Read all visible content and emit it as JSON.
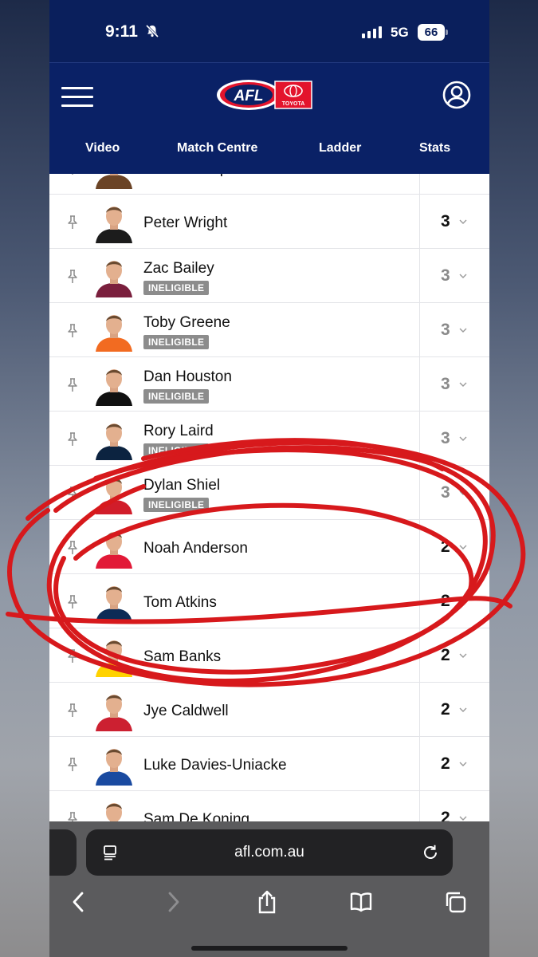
{
  "status_bar": {
    "time": "9:11",
    "network": "5G",
    "battery": "66"
  },
  "header": {
    "logo_text": "AFL",
    "sponsor_text": "TOYOTA",
    "nav": [
      "Video",
      "Match Centre",
      "Ladder",
      "Stats"
    ]
  },
  "players": [
    {
      "name": "James Worpel",
      "badge": "",
      "votes": "",
      "dim": false
    },
    {
      "name": "Peter Wright",
      "badge": "",
      "votes": "3",
      "dim": false
    },
    {
      "name": "Zac Bailey",
      "badge": "INELIGIBLE",
      "votes": "3",
      "dim": true
    },
    {
      "name": "Toby Greene",
      "badge": "INELIGIBLE",
      "votes": "3",
      "dim": true
    },
    {
      "name": "Dan Houston",
      "badge": "INELIGIBLE",
      "votes": "3",
      "dim": true
    },
    {
      "name": "Rory Laird",
      "badge": "INELIGIBLE",
      "votes": "3",
      "dim": true
    },
    {
      "name": "Dylan Shiel",
      "badge": "INELIGIBLE",
      "votes": "3",
      "dim": true
    },
    {
      "name": "Noah Anderson",
      "badge": "",
      "votes": "2",
      "dim": false
    },
    {
      "name": "Tom Atkins",
      "badge": "",
      "votes": "2",
      "dim": false
    },
    {
      "name": "Sam Banks",
      "badge": "",
      "votes": "2",
      "dim": false
    },
    {
      "name": "Jye Caldwell",
      "badge": "",
      "votes": "2",
      "dim": false
    },
    {
      "name": "Luke Davies-Uniacke",
      "badge": "",
      "votes": "2",
      "dim": false
    },
    {
      "name": "Sam De Koning",
      "badge": "",
      "votes": "2",
      "dim": false
    }
  ],
  "jersey_colors": [
    "#6b4426",
    "#1c1c1c",
    "#7a1f3d",
    "#f26b21",
    "#111111",
    "#0c2340",
    "#d11d2a",
    "#e21937",
    "#0c2b56",
    "#ffd200",
    "#cc2031",
    "#1a4aa0",
    "#e6e6e6"
  ],
  "browser": {
    "url": "afl.com.au"
  }
}
